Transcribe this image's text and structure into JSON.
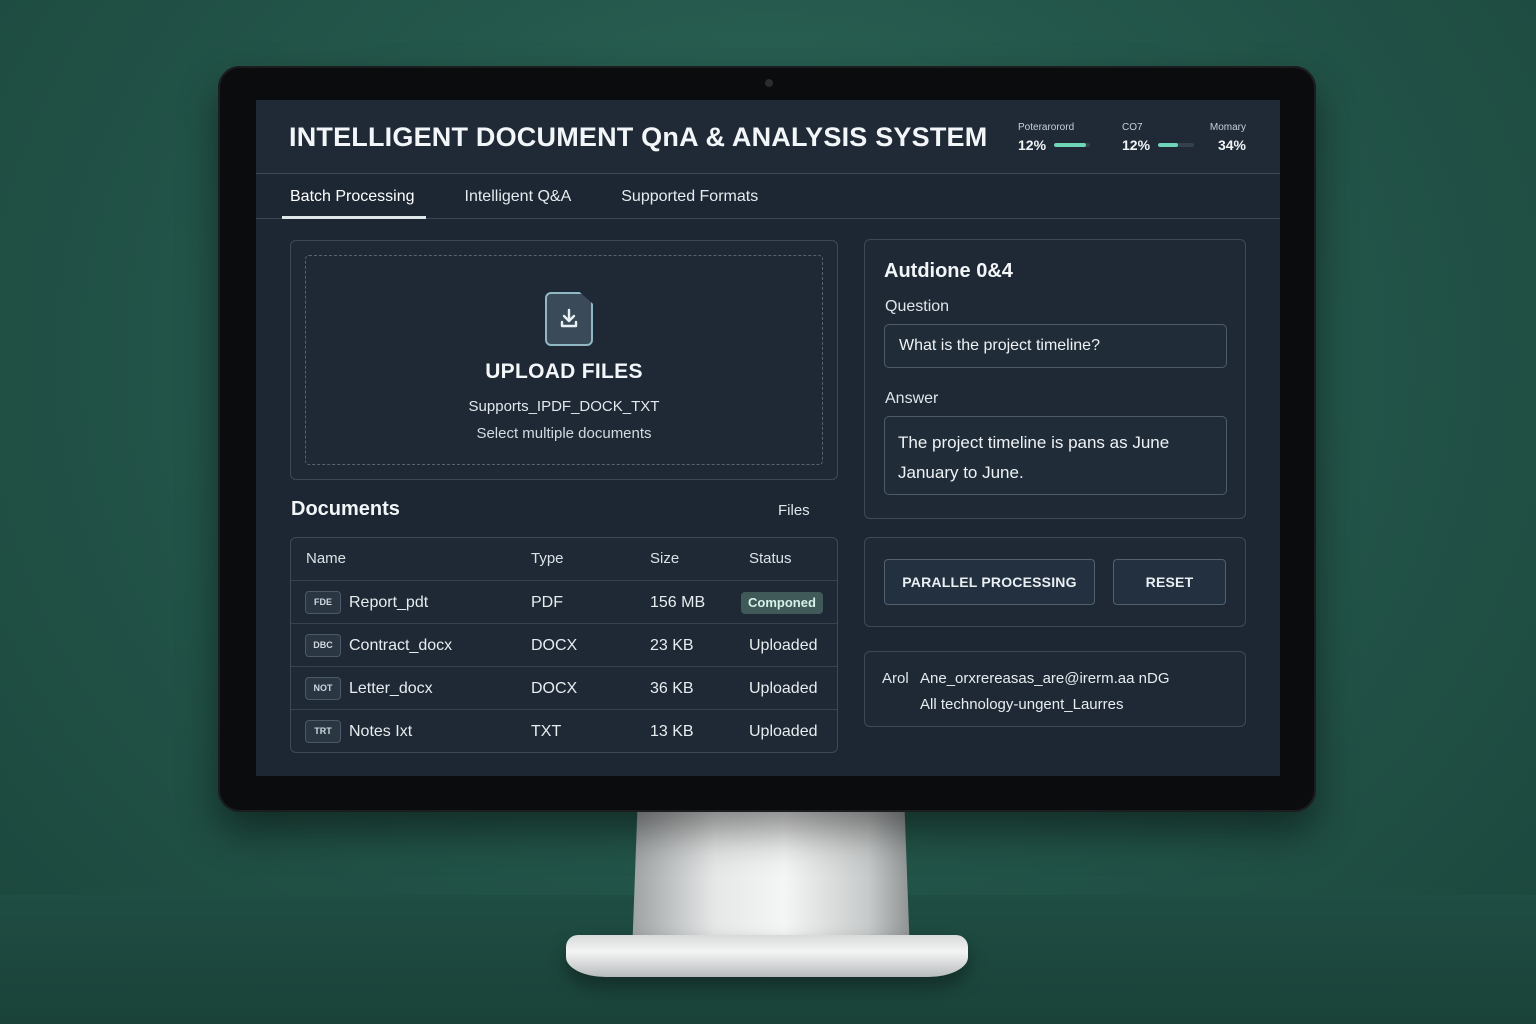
{
  "app": {
    "title": "INTELLIGENT DOCUMENT QnA & ANALYSIS SYSTEM"
  },
  "metrics": [
    {
      "label": "Poterarorord",
      "value": "12%",
      "level": 0.9
    },
    {
      "label": "CO7",
      "value": "12%",
      "level": 0.55
    },
    {
      "label": "Momary",
      "value": "34%",
      "level": 0
    }
  ],
  "tabs": [
    {
      "label": "Batch Processing",
      "active": true
    },
    {
      "label": "Intelligent Q&A",
      "active": false
    },
    {
      "label": "Supported Formats",
      "active": false
    }
  ],
  "upload": {
    "heading": "UPLOAD FILES",
    "supports": "Supports_IPDF_DOCK_TXT",
    "hint": "Select multiple documents"
  },
  "documents": {
    "title": "Documents",
    "files_link": "Files",
    "columns": [
      "Name",
      "Type",
      "Size",
      "Status"
    ],
    "rows": [
      {
        "icon_text": "FDE",
        "name": "Report_pdt",
        "type": "PDF",
        "size": "156 MB",
        "status": "Componed",
        "status_highlight": true
      },
      {
        "icon_text": "DBC",
        "name": "Contract_docx",
        "type": "DOCX",
        "size": "23 KB",
        "status": "Uploaded",
        "status_highlight": false
      },
      {
        "icon_text": "NOT",
        "name": "Letter_docx",
        "type": "DOCX",
        "size": "36 KB",
        "status": "Uploaded",
        "status_highlight": false
      },
      {
        "icon_text": "TRT",
        "name": "Notes Ixt",
        "type": "TXT",
        "size": "13 KB",
        "status": "Uploaded",
        "status_highlight": false
      }
    ]
  },
  "qna": {
    "title": "Autdione 0&4",
    "question_label": "Question",
    "question_value": "What is the project timeline?",
    "answer_label": "Answer",
    "answer_value": "The project timeline is pans as June January to June."
  },
  "actions": {
    "parallel_label": "PARALLEL PROCESSING",
    "reset_label": "RESET"
  },
  "info": {
    "prefix": "Arol",
    "line1": "Ane_orxrereasas_are@irerm.aa nDG",
    "line2": "All technology-ungent_Laurres"
  },
  "colors": {
    "accent": "#6fd6b8",
    "background": "#24574b",
    "screen": "#1c2733"
  }
}
